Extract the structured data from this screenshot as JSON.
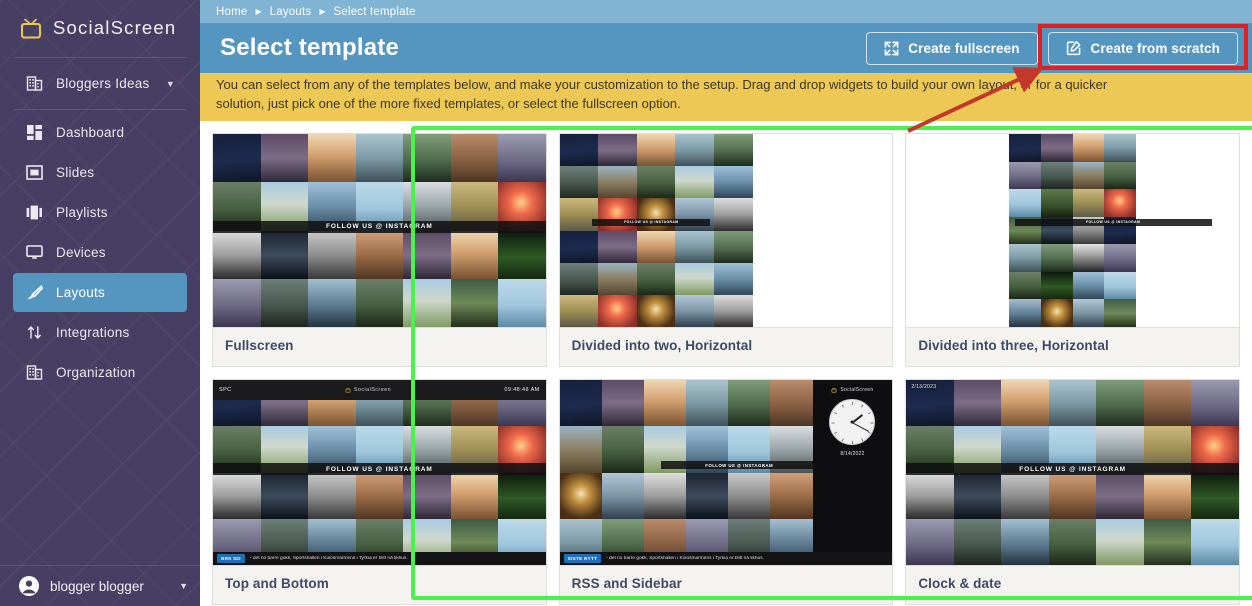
{
  "sidebar": {
    "brand": {
      "name": "SocialScreen",
      "icon": "tv-icon"
    },
    "org": {
      "label": "Bloggers Ideas",
      "icon": "building-icon",
      "caret": "▼"
    },
    "items": [
      {
        "label": "Dashboard",
        "icon": "dashboard-icon",
        "active": false
      },
      {
        "label": "Slides",
        "icon": "slides-icon",
        "active": false
      },
      {
        "label": "Playlists",
        "icon": "playlists-icon",
        "active": false
      },
      {
        "label": "Devices",
        "icon": "devices-icon",
        "active": false
      },
      {
        "label": "Layouts",
        "icon": "layouts-brush-icon",
        "active": true
      },
      {
        "label": "Integrations",
        "icon": "integrations-arrows-icon",
        "active": false
      },
      {
        "label": "Organization",
        "icon": "organization-building-icon",
        "active": false
      }
    ],
    "user": {
      "name": "blogger blogger",
      "icon": "user-avatar-icon",
      "caret": "▼"
    }
  },
  "breadcrumb": {
    "items": [
      "Home",
      "Layouts",
      "Select template"
    ],
    "separator": "▶"
  },
  "header": {
    "title": "Select template",
    "buttons": [
      {
        "label": "Create fullscreen",
        "icon": "expand-arrows-icon"
      },
      {
        "label": "Create from scratch",
        "icon": "pencil-square-icon"
      }
    ]
  },
  "alert": {
    "line1": "You can select from any of the templates below, and make your customization to the setup. Drag and drop widgets to build your own layout, or for a quicker",
    "line2": "solution, just pick one of the more fixed templates, or select the fullscreen option."
  },
  "templates": [
    {
      "name": "Fullscreen",
      "layout": "full"
    },
    {
      "name": "Divided into two, Horizontal",
      "layout": "half"
    },
    {
      "name": "Divided into three, Horizontal",
      "layout": "third"
    },
    {
      "name": "Top and Bottom",
      "layout": "topbottom"
    },
    {
      "name": "RSS and Sidebar",
      "layout": "rsssidebar"
    },
    {
      "name": "Clock & date",
      "layout": "clockdate"
    }
  ],
  "preview_overlays": {
    "instagram_banner": "FOLLOW US @ INSTAGRAM",
    "topbar_left": "SPC",
    "topbar_center": "SocialScreen",
    "topbar_right": "09:48:48 AM",
    "ticker_tag_top": "NRK NO",
    "ticker_tag_rss": "SISTE NYTT",
    "ticker_text": "- det no barre gokk, Sportshallen i Kulosmarmens i Tyrkia er blitt nå likhus.",
    "sidebar_brand": "SocialScreen",
    "sidebar_date": "8/14/2022",
    "clockdate_stamp": "2/13/2023"
  },
  "annotations": {
    "green_highlight_color": "#4cf24c",
    "red_highlight_color": "#e02020",
    "arrow_color": "#c0392b"
  },
  "colors": {
    "sidebar_bg": "#473f63",
    "sidebar_active": "#5596c1",
    "header_bg": "#5596c1",
    "breadcrumb_bg": "#81b3d2",
    "alert_bg": "#edc855",
    "card_bg": "#f4f3ef",
    "label_text": "#3d4a66",
    "brand_icon": "#eec84b"
  }
}
